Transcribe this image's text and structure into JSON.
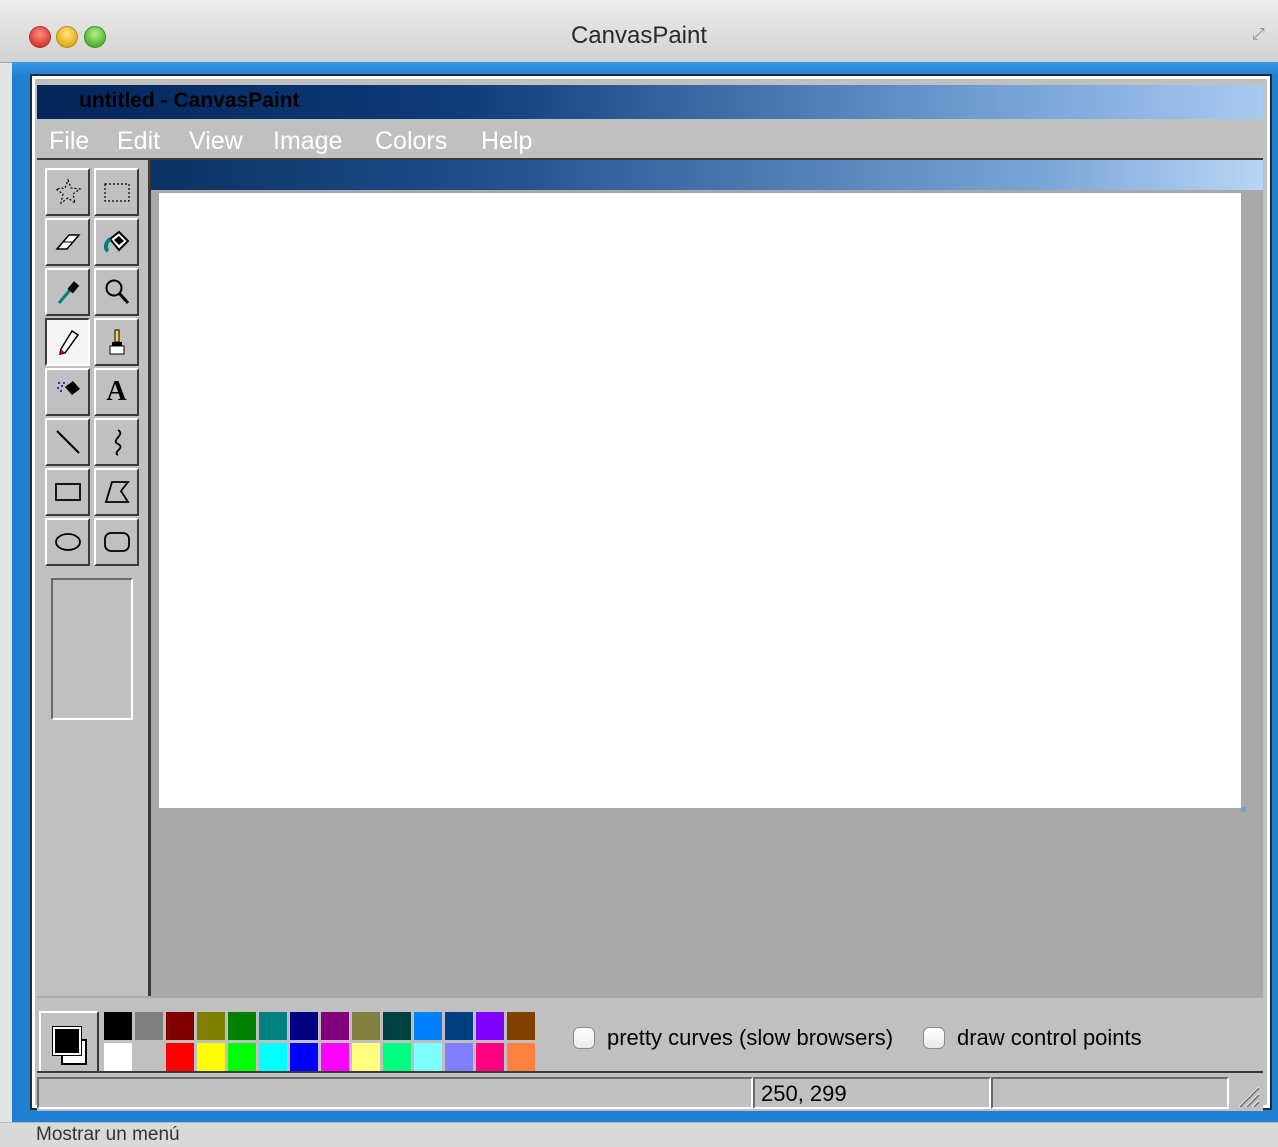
{
  "app": {
    "mac_title": "CanvasPaint",
    "document_title": "untitled - CanvasPaint"
  },
  "menu": [
    {
      "label": "File"
    },
    {
      "label": "Edit"
    },
    {
      "label": "View"
    },
    {
      "label": "Image"
    },
    {
      "label": "Colors"
    },
    {
      "label": "Help"
    }
  ],
  "tools": [
    {
      "name": "free-form-select",
      "icon": "star-select-icon"
    },
    {
      "name": "rect-select",
      "icon": "rect-select-icon"
    },
    {
      "name": "eraser",
      "icon": "eraser-icon"
    },
    {
      "name": "fill",
      "icon": "paint-bucket-icon"
    },
    {
      "name": "pick-color",
      "icon": "eyedropper-icon"
    },
    {
      "name": "magnifier",
      "icon": "magnifier-icon"
    },
    {
      "name": "pencil",
      "icon": "pencil-icon",
      "active": true
    },
    {
      "name": "brush",
      "icon": "brush-icon"
    },
    {
      "name": "airbrush",
      "icon": "airbrush-icon"
    },
    {
      "name": "text",
      "icon": "text-icon",
      "glyph": "A"
    },
    {
      "name": "line",
      "icon": "line-icon"
    },
    {
      "name": "curve",
      "icon": "curve-icon"
    },
    {
      "name": "rectangle",
      "icon": "rectangle-icon"
    },
    {
      "name": "polygon",
      "icon": "polygon-icon"
    },
    {
      "name": "ellipse",
      "icon": "ellipse-icon"
    },
    {
      "name": "rounded-rect",
      "icon": "rounded-rect-icon"
    }
  ],
  "current_colors": {
    "foreground": "#000000",
    "background": "#ffffff"
  },
  "palette": {
    "top": [
      "#000000",
      "#808080",
      "#800000",
      "#808000",
      "#008000",
      "#008080",
      "#000080",
      "#800080",
      "#808040",
      "#004040",
      "#0080ff",
      "#004080",
      "#8000ff",
      "#804000"
    ],
    "bottom": [
      "#ffffff",
      "#c0c0c0",
      "#ff0000",
      "#ffff00",
      "#00ff00",
      "#00ffff",
      "#0000ff",
      "#ff00ff",
      "#ffff80",
      "#00ff80",
      "#80ffff",
      "#8080ff",
      "#ff0080",
      "#ff8040"
    ]
  },
  "options": {
    "pretty_curves": {
      "label": "pretty curves (slow browsers)",
      "checked": false
    },
    "draw_control_points": {
      "label": "draw control points",
      "checked": false
    }
  },
  "status": {
    "message": "",
    "coords": "250, 299",
    "extra": ""
  },
  "os_status": "Mostrar un menú"
}
